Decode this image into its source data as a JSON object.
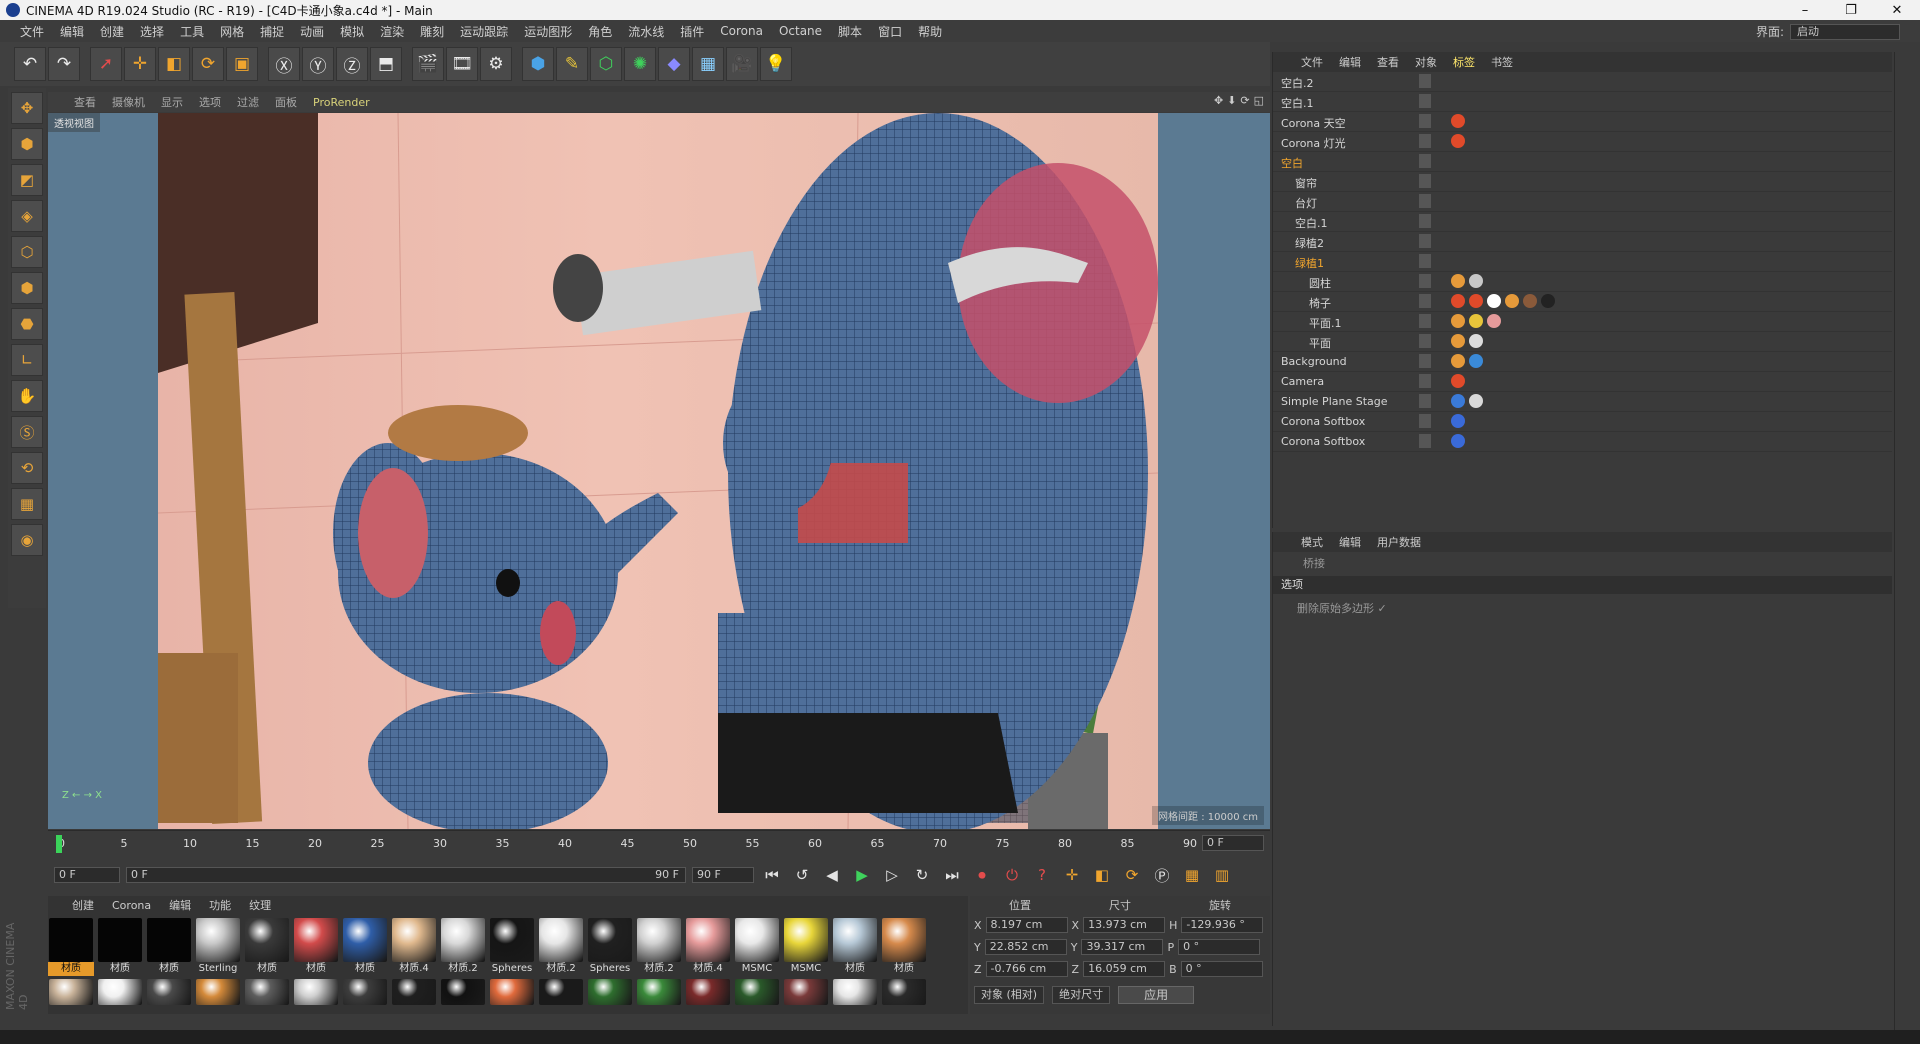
{
  "window": {
    "title": "CINEMA 4D R19.024 Studio (RC - R19) - [C4D卡通小象a.c4d *] - Main",
    "min": "–",
    "max": "❐",
    "close": "✕"
  },
  "menu": [
    "文件",
    "编辑",
    "创建",
    "选择",
    "工具",
    "网格",
    "捕捉",
    "动画",
    "模拟",
    "渲染",
    "雕刻",
    "运动跟踪",
    "运动图形",
    "角色",
    "流水线",
    "插件",
    "Corona",
    "Octane",
    "脚本",
    "窗口",
    "帮助"
  ],
  "layout": {
    "label": "界面:",
    "value": "启动"
  },
  "viewport": {
    "tabs": [
      "查看",
      "摄像机",
      "显示",
      "选项",
      "过滤",
      "面板",
      "ProRender"
    ],
    "tag": "透视视图",
    "grid_distance": "网格间距 : 10000 cm",
    "axes": "Z ← → X"
  },
  "timeline": {
    "ticks": [
      "0",
      "5",
      "10",
      "15",
      "20",
      "25",
      "30",
      "35",
      "40",
      "45",
      "50",
      "55",
      "60",
      "65",
      "70",
      "75",
      "80",
      "85",
      "90"
    ],
    "current_frame": "0 F",
    "start": "0 F",
    "range_start": "0 F",
    "range_end": "90 F",
    "end": "90 F"
  },
  "materials": {
    "tabs": [
      "创建",
      "Corona",
      "编辑",
      "功能",
      "纹理"
    ],
    "row1": [
      {
        "name": "材质",
        "color": "#050505",
        "sel": true
      },
      {
        "name": "材质",
        "color": "#050505"
      },
      {
        "name": "材质",
        "color": "#050505"
      },
      {
        "name": "Sterling",
        "color": "#c8c8c8"
      },
      {
        "name": "材质",
        "color": "#3a3a3a"
      },
      {
        "name": "材质",
        "color": "#d24b4b"
      },
      {
        "name": "材质",
        "color": "#2f5ea8"
      },
      {
        "name": "材质.4",
        "color": "#e0b98e"
      },
      {
        "name": "材质.2",
        "color": "#d8d8d8"
      },
      {
        "name": "Spheres",
        "color": "#151515"
      },
      {
        "name": "材质.2",
        "color": "#e6e6e6"
      },
      {
        "name": "Spheres",
        "color": "#202020"
      },
      {
        "name": "材质.2",
        "color": "#d0d0d0"
      },
      {
        "name": "材质.4",
        "color": "#e69b9b"
      },
      {
        "name": "MSMC",
        "color": "#e8e8e8"
      },
      {
        "name": "MSMC",
        "color": "#e8d63a"
      },
      {
        "name": "材质",
        "color": "#b6c8d6"
      },
      {
        "name": "材质",
        "color": "#d68a4c"
      }
    ],
    "row2": [
      "#c9b39a",
      "#f0f0f0",
      "#4a4a4a",
      "#d48a3a",
      "#5d5d5d",
      "#cfcfcf",
      "#3d3d3d",
      "#1f1f1f",
      "#111111",
      "#e06a3c",
      "#1a1a1a",
      "#2e6e2e",
      "#3a8a3a",
      "#7a2a2a",
      "#2a5a2a",
      "#7a3a3a",
      "#e6e6e6",
      "#2a2a2a"
    ]
  },
  "coords": {
    "headers": [
      "位置",
      "尺寸",
      "旋转"
    ],
    "rows": [
      {
        "a": "X",
        "pos": "8.197 cm",
        "b": "X",
        "size": "13.973 cm",
        "c": "H",
        "rot": "-129.936 °"
      },
      {
        "a": "Y",
        "pos": "22.852 cm",
        "b": "Y",
        "size": "39.317 cm",
        "c": "P",
        "rot": "0 °"
      },
      {
        "a": "Z",
        "pos": "-0.766 cm",
        "b": "Z",
        "size": "16.059 cm",
        "c": "B",
        "rot": "0 °"
      }
    ],
    "mode": "对象 (相对)",
    "size_mode": "绝对尺寸",
    "apply": "应用"
  },
  "objmgr": {
    "tabs": [
      "文件",
      "编辑",
      "查看",
      "对象",
      "标签",
      "书签"
    ],
    "active_tab": "标签",
    "items": [
      {
        "name": "空白.2",
        "indent": 0,
        "hl": false
      },
      {
        "name": "空白.1",
        "indent": 0,
        "hl": false
      },
      {
        "name": "Corona 天空",
        "indent": 0,
        "hl": false,
        "tags": [
          "#e04a2a"
        ]
      },
      {
        "name": "Corona 灯光",
        "indent": 0,
        "hl": false,
        "tags": [
          "#e04a2a"
        ]
      },
      {
        "name": "空白",
        "indent": 0,
        "hl": true
      },
      {
        "name": "窗帘",
        "indent": 1,
        "hl": false
      },
      {
        "name": "台灯",
        "indent": 1,
        "hl": false
      },
      {
        "name": "空白.1",
        "indent": 1,
        "hl": false
      },
      {
        "name": "绿植2",
        "indent": 1,
        "hl": false
      },
      {
        "name": "绿植1",
        "indent": 1,
        "hl": true
      },
      {
        "name": "圆柱",
        "indent": 2,
        "hl": false,
        "tags": [
          "#e69a3a",
          "#c8c8c8"
        ]
      },
      {
        "name": "椅子",
        "indent": 2,
        "hl": false,
        "tags": [
          "#e04a2a",
          "#e04a2a",
          "#ffffff",
          "#e69a3a",
          "#8a5a3a",
          "#222222"
        ]
      },
      {
        "name": "平面.1",
        "indent": 2,
        "hl": false,
        "tags": [
          "#e69a3a",
          "#e8c53a",
          "#e69b9b"
        ]
      },
      {
        "name": "平面",
        "indent": 2,
        "hl": false,
        "tags": [
          "#e69a3a",
          "#dcdcdc"
        ]
      },
      {
        "name": "Background",
        "indent": 0,
        "hl": false,
        "tags": [
          "#e69a3a",
          "#3a8ad8"
        ]
      },
      {
        "name": "Camera",
        "indent": 0,
        "hl": false,
        "tags": [
          "#e04a2a"
        ]
      },
      {
        "name": "Simple Plane Stage",
        "indent": 0,
        "hl": false,
        "tags": [
          "#3a7ad8",
          "#d8d8d8"
        ]
      },
      {
        "name": "Corona Softbox",
        "indent": 0,
        "hl": false,
        "tags": [
          "#3a6ad8"
        ]
      },
      {
        "name": "Corona Softbox",
        "indent": 0,
        "hl": false,
        "tags": [
          "#3a6ad8"
        ]
      }
    ]
  },
  "attrmgr": {
    "tabs": [
      "模式",
      "编辑",
      "用户数据"
    ],
    "title": "桥接",
    "section": "选项",
    "option": "删除原始多边形 ✓"
  },
  "brand": "MAXON CINEMA 4D"
}
